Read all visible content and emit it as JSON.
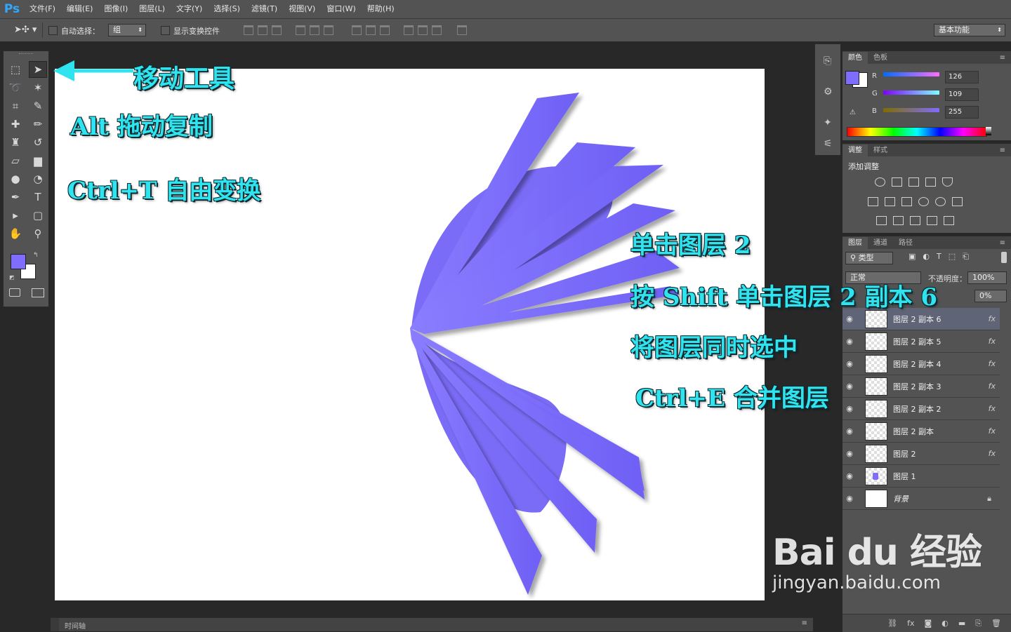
{
  "app": {
    "logo": "Ps"
  },
  "menu": [
    "文件(F)",
    "编辑(E)",
    "图像(I)",
    "图层(L)",
    "文字(Y)",
    "选择(S)",
    "滤镜(T)",
    "视图(V)",
    "窗口(W)",
    "帮助(H)"
  ],
  "options": {
    "auto_select_label": "自动选择：",
    "auto_select_value": "组",
    "show_transform_label": "显示变换控件",
    "workspace": "基本功能"
  },
  "annotations": {
    "move_tool": "移动工具",
    "alt_drag": "Alt 拖动复制",
    "free_transform": "Ctrl+T 自由变换",
    "step1": "单击图层 2",
    "step2": "按 Shift 单击图层 2 副本 6",
    "step3": "将图层同时选中",
    "step4": "Ctrl+E 合并图层"
  },
  "color_panel": {
    "tabs": [
      "颜色",
      "色板"
    ],
    "r_label": "R",
    "g_label": "G",
    "b_label": "B",
    "r": "126",
    "g": "109",
    "b": "255",
    "fg_color": "#7e6dff",
    "bg_color": "#ffffff"
  },
  "adjust_panel": {
    "tabs": [
      "调整",
      "样式"
    ],
    "title": "添加调整"
  },
  "layers_panel": {
    "tabs": [
      "图层",
      "通道",
      "路径"
    ],
    "filter_label": "类型",
    "blend_mode": "正常",
    "opacity_label": "不透明度：",
    "opacity": "100%",
    "fill": "0%",
    "layers": [
      {
        "name": "图层 2 副本 6",
        "fx": "fx"
      },
      {
        "name": "图层 2 副本 5",
        "fx": "fx"
      },
      {
        "name": "图层 2 副本 4",
        "fx": "fx"
      },
      {
        "name": "图层 2 副本 3",
        "fx": "fx"
      },
      {
        "name": "图层 2 副本 2",
        "fx": "fx"
      },
      {
        "name": "图层 2 副本",
        "fx": "fx"
      },
      {
        "name": "图层 2",
        "fx": "fx"
      },
      {
        "name": "图层 1",
        "fx": ""
      },
      {
        "name": "背景",
        "fx": ""
      }
    ]
  },
  "timeline": {
    "label": "时间轴"
  },
  "watermark": {
    "brand": "Bai du 经验",
    "url": "jingyan.baidu.com"
  }
}
